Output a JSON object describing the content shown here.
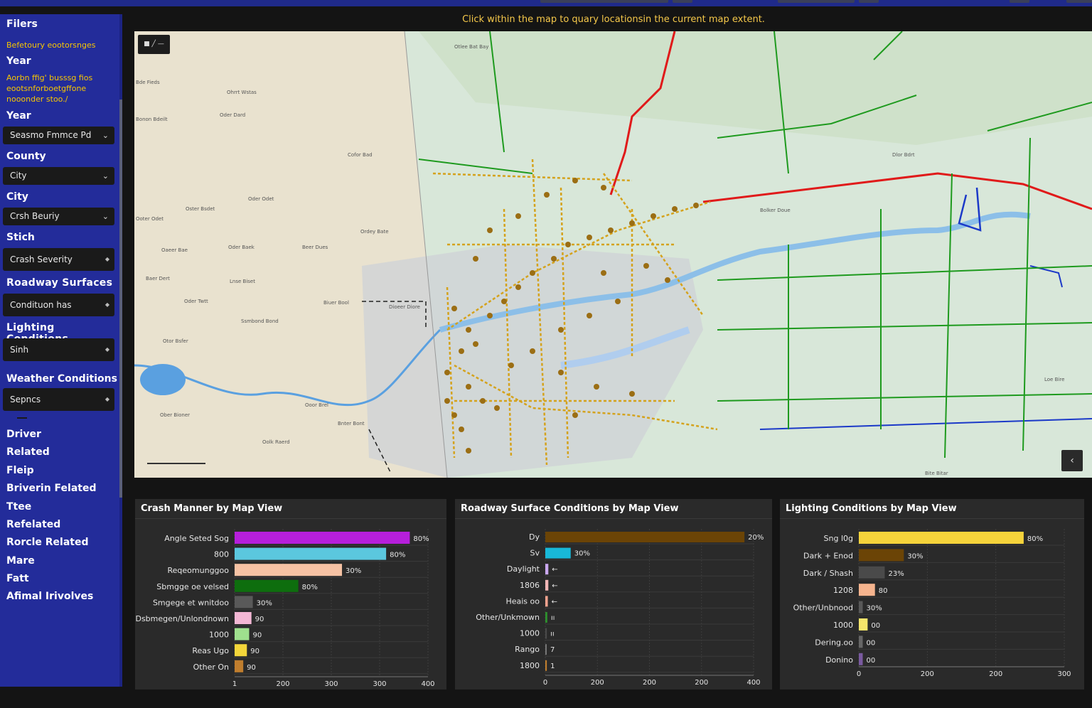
{
  "header": {
    "hint": "Click within the map to quary locationsin the current map extent."
  },
  "sidebar": {
    "filters_title": "Filers",
    "note1": "Befetoury eootorsnges",
    "year1": "Year",
    "note2": "Aorbn ffig' busssg fios eootsnforboetgffone nooonder stoo./",
    "year2": "Year",
    "select_year": "Seasmo Fmmce Pd",
    "county": "County",
    "select_county": "City",
    "city": "City",
    "select_city": "Crsh Beuriy",
    "stich": "Stich",
    "select_severity": "Crash Severity",
    "roadway": "Roadway Surfaces",
    "select_roadway": "Condituon has",
    "lighting": "Lighting Conditions",
    "select_lighting": "Sinh",
    "weather": "Weather Conditions",
    "select_weather": "Sepncs",
    "items": [
      "Driver",
      "Related",
      "Fleip",
      "Briverin Felated",
      "Ttee",
      "Refelated",
      "Rorcle Related",
      "Mare",
      "Fatt",
      "Afimal Irivolves"
    ]
  },
  "map": {
    "btn_tl": "■ ╱ —",
    "btn_br": "‹",
    "labels": [
      "Otlee Bat Bay",
      "Ohrrt Wstas",
      "Bde Fieds",
      "Bonon Bdeilt",
      "Oder Dard",
      "Cofor Bad",
      "Oder Odet",
      "Oster Bsdet",
      "Ooter Odet",
      "Oaeer Bae",
      "Oder Baek",
      "Beer Dues",
      "Ordey Bate",
      "Baer Dert",
      "Lnse Biset",
      "Oder Twtt",
      "Biuer Bool",
      "Dioeer Diore",
      "Ssmbond Bond",
      "Otor Bsfer",
      "Ober Bioner",
      "Ooor Brel",
      "Bnter Bont",
      "Oolk Raerd",
      "Dlor Bdrt",
      "Bolker Doue",
      "Loe Bire",
      "Bite Bitar"
    ]
  },
  "charts": [
    {
      "title": "Crash Manner by Map View",
      "chart_data": {
        "type": "bar",
        "orientation": "horizontal",
        "categories": [
          "Angle Seted Sog",
          "800",
          "Reqeomunggoo",
          "Sbmgge oe velsed",
          "Smgege et wnitdoo",
          "Dsbmegen/Unlondnown",
          "1000",
          "Reas Ugo",
          "Other On"
        ],
        "values": [
          385,
          333,
          236,
          140,
          40,
          37,
          32,
          27,
          19
        ],
        "value_labels": [
          "80%",
          "80%",
          "30%",
          "80%",
          "30%",
          "90",
          "90",
          "90",
          "90"
        ],
        "colors": [
          "#b61fdb",
          "#5bc7de",
          "#f6c2a4",
          "#0e6e0e",
          "#595959",
          "#f3b7d4",
          "#9fe08e",
          "#f3d63a",
          "#c07e2e"
        ],
        "x_ticks": [
          "1",
          "200",
          "300",
          "300",
          "400"
        ],
        "xlim": [
          0,
          425
        ]
      }
    },
    {
      "title": "Roadway Surface Conditions by Map View",
      "chart_data": {
        "type": "bar",
        "orientation": "horizontal",
        "categories": [
          "Dy",
          "Sv",
          "Daylight",
          "1806",
          "Heais oo",
          "Other/Unkmown",
          "1000",
          "Rango",
          "1800"
        ],
        "values": [
          392,
          50,
          6,
          6,
          5,
          4,
          3,
          2,
          3
        ],
        "value_labels": [
          "20%",
          "30%",
          "←",
          "←",
          "←",
          "ıı",
          "ıı",
          "7",
          "1"
        ],
        "colors": [
          "#6b4406",
          "#18b8d8",
          "#caa8f0",
          "#f3b7b7",
          "#f3a28e",
          "#2d8f2d",
          "#4a4a4a",
          "#777777",
          "#c07e2e"
        ],
        "x_ticks": [
          "0",
          "200",
          "200",
          "200",
          "400"
        ],
        "xlim": [
          0,
          410
        ]
      }
    },
    {
      "title": "Lighting Conditions by Map View",
      "chart_data": {
        "type": "bar",
        "orientation": "horizontal",
        "categories": [
          "Sng l0g",
          "Dark + Enod",
          "Dark / Shash",
          "1208",
          "Other/Unbnood",
          "1000",
          "Dering.oo",
          "Donino"
        ],
        "values": [
          337,
          92,
          53,
          33,
          8,
          18,
          8,
          8
        ],
        "value_labels": [
          "80%",
          "30%",
          "23%",
          "80",
          "30%",
          "00",
          "00",
          "00"
        ],
        "colors": [
          "#f5d33b",
          "#6b4406",
          "#4a4a4a",
          "#f6b48e",
          "#595959",
          "#f5e56b",
          "#666666",
          "#7a5aa0"
        ],
        "x_ticks": [
          "0",
          "200",
          "200",
          "300"
        ],
        "xlim": [
          0,
          420
        ]
      }
    }
  ]
}
